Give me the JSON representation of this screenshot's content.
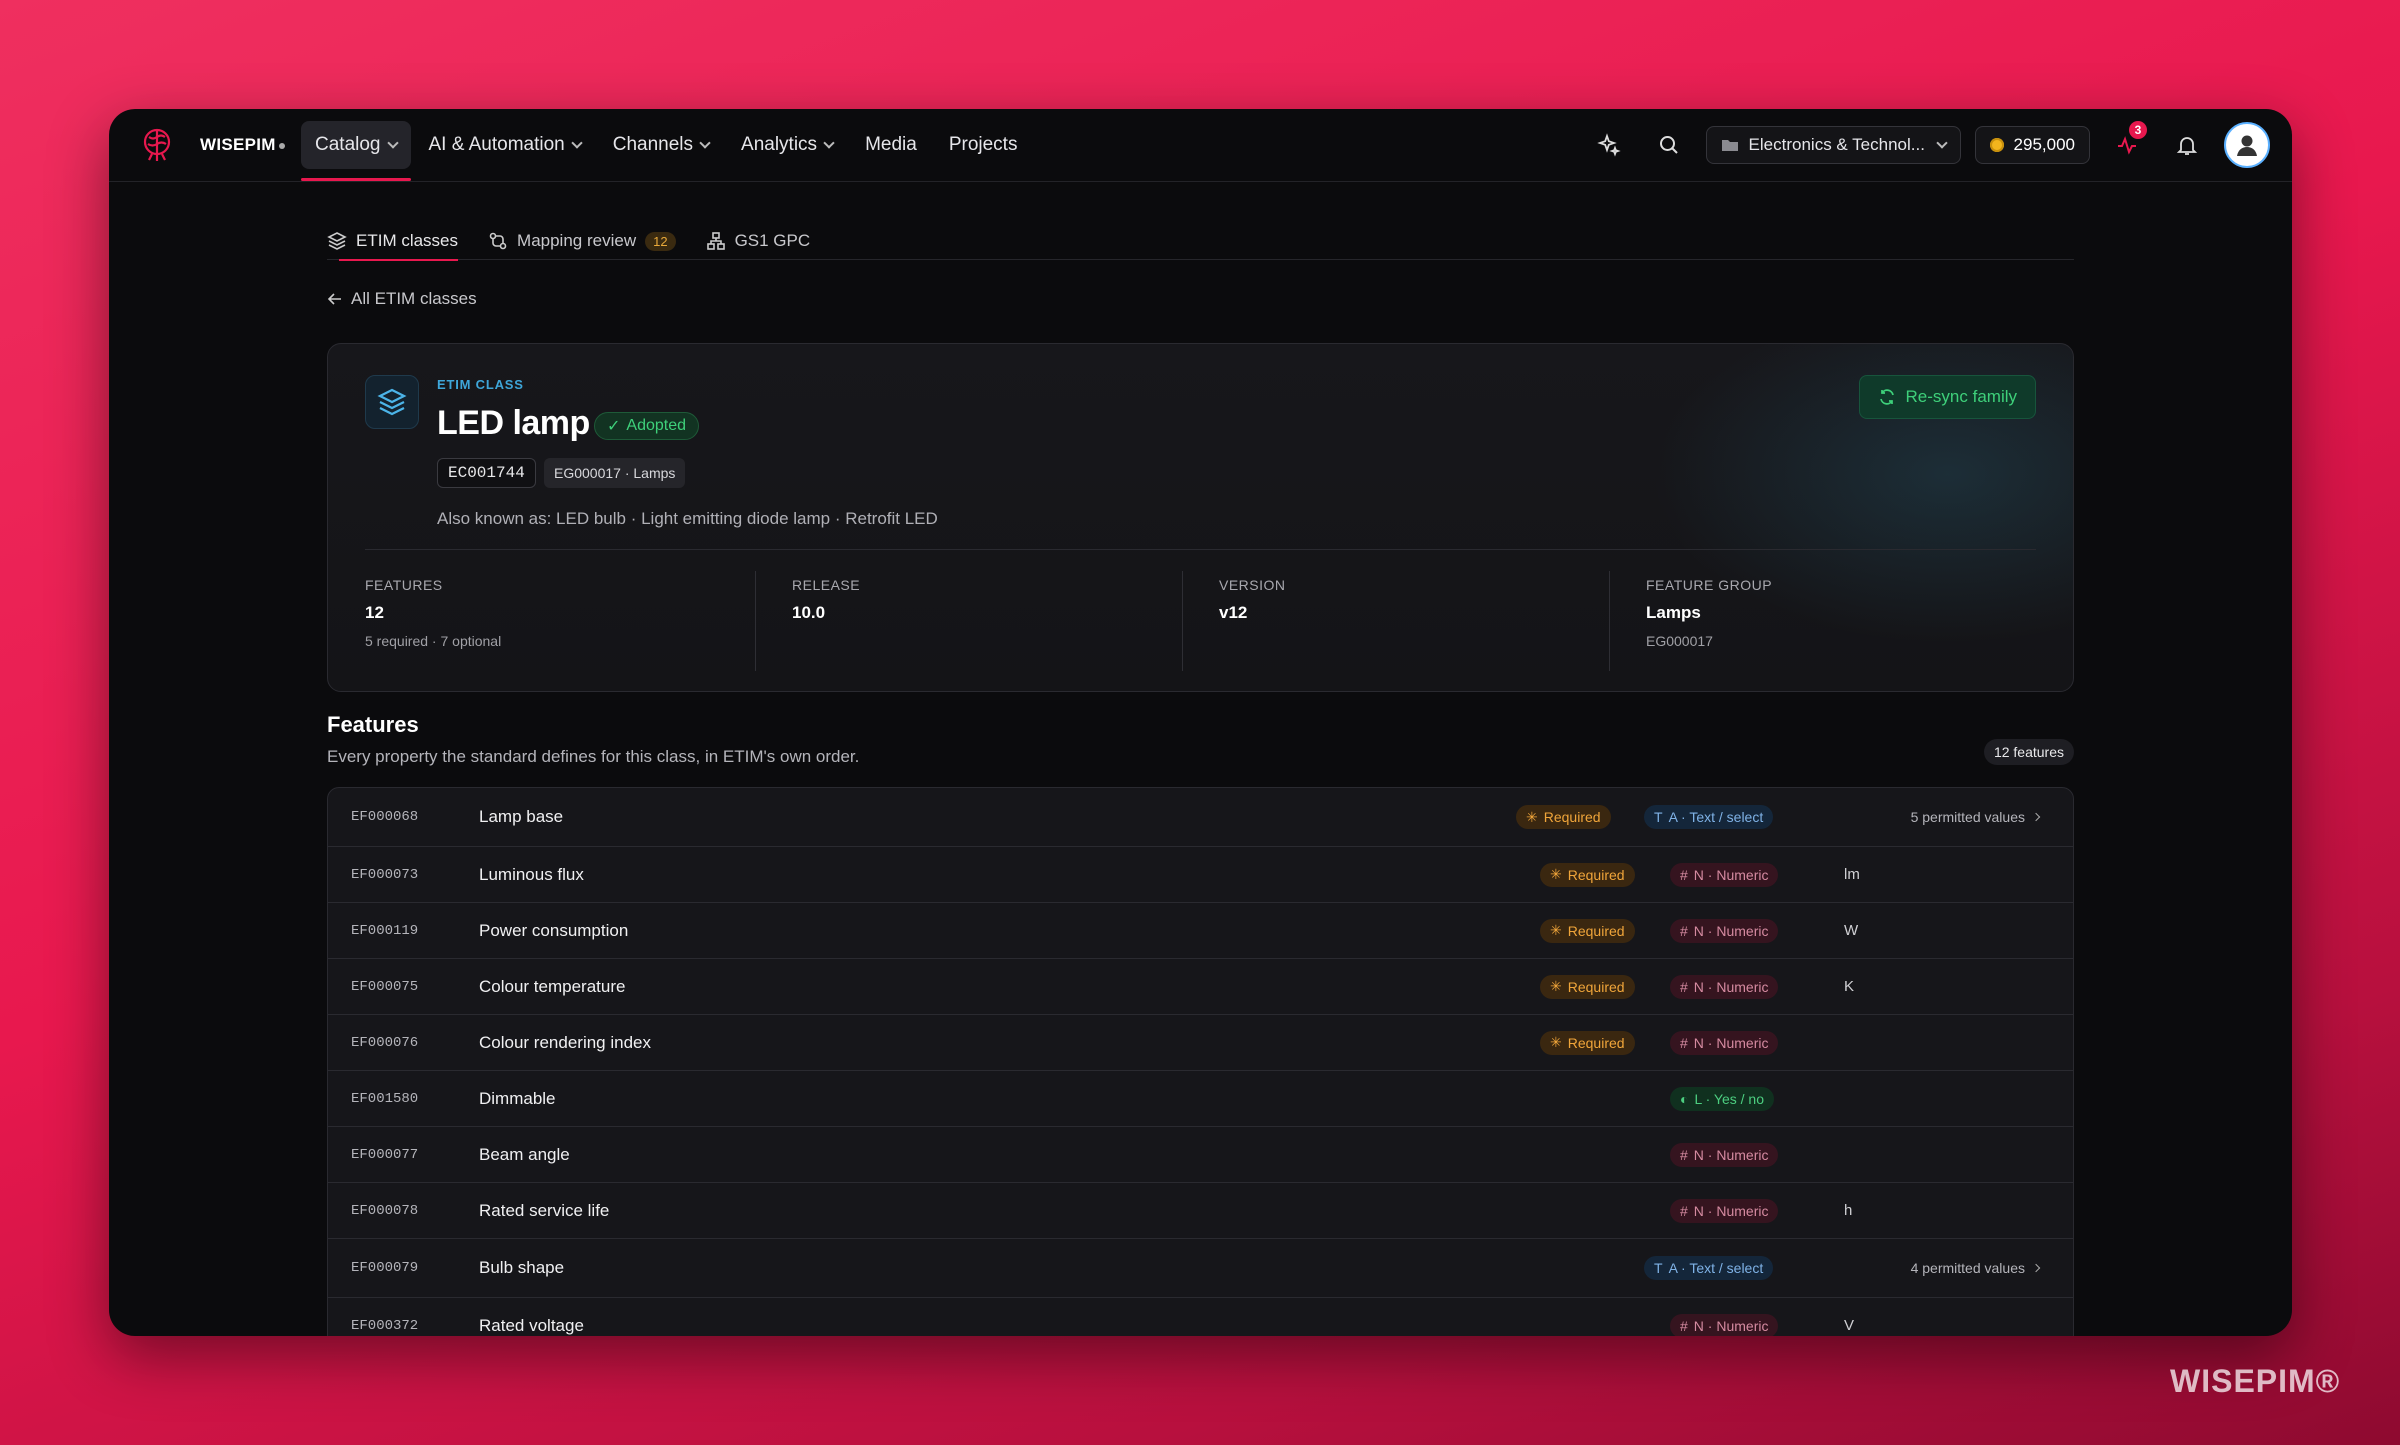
{
  "brand": {
    "name": "WISEPIM"
  },
  "nav": {
    "items": [
      {
        "label": "Catalog",
        "dropdown": true
      },
      {
        "label": "AI & Automation",
        "dropdown": true
      },
      {
        "label": "Channels",
        "dropdown": true
      },
      {
        "label": "Analytics",
        "dropdown": true
      },
      {
        "label": "Media",
        "dropdown": false
      },
      {
        "label": "Projects",
        "dropdown": false
      }
    ]
  },
  "topbar": {
    "workspace": "Electronics & Technol...",
    "credits": "295,000",
    "notifications_count": "3"
  },
  "subtabs": [
    {
      "label": "ETIM classes",
      "active": true
    },
    {
      "label": "Mapping review",
      "count": "12"
    },
    {
      "label": "GS1 GPC"
    }
  ],
  "back_link": "All ETIM classes",
  "class_card": {
    "eyebrow": "ETIM CLASS",
    "title": "LED lamp",
    "status": "Adopted",
    "code": "EC001744",
    "group": "EG000017 · Lamps",
    "aka": "Also known as: LED bulb · Light emitting diode lamp · Retrofit LED",
    "resync_label": "Re-sync family",
    "stats": [
      {
        "label": "FEATURES",
        "value": "12",
        "sub": "5 required · 7 optional"
      },
      {
        "label": "RELEASE",
        "value": "10.0",
        "sub": ""
      },
      {
        "label": "VERSION",
        "value": "v12",
        "sub": ""
      },
      {
        "label": "FEATURE GROUP",
        "value": "Lamps",
        "sub": "EG000017"
      }
    ]
  },
  "features_section": {
    "title": "Features",
    "description": "Every property the standard defines for this class, in ETIM's own order.",
    "count_label": "12 features"
  },
  "features": [
    {
      "code": "EF000068",
      "name": "Lamp base",
      "required": "Required",
      "type": "A · Text / select",
      "kind": "text",
      "unit": "",
      "permitted": "5 permitted values"
    },
    {
      "code": "EF000073",
      "name": "Luminous flux",
      "required": "Required",
      "type": "N · Numeric",
      "kind": "numeric",
      "unit": "lm",
      "permitted": ""
    },
    {
      "code": "EF000119",
      "name": "Power consumption",
      "required": "Required",
      "type": "N · Numeric",
      "kind": "numeric",
      "unit": "W",
      "permitted": ""
    },
    {
      "code": "EF000075",
      "name": "Colour temperature",
      "required": "Required",
      "type": "N · Numeric",
      "kind": "numeric",
      "unit": "K",
      "permitted": ""
    },
    {
      "code": "EF000076",
      "name": "Colour rendering index",
      "required": "Required",
      "type": "N · Numeric",
      "kind": "numeric",
      "unit": "",
      "permitted": ""
    },
    {
      "code": "EF001580",
      "name": "Dimmable",
      "required": "",
      "type": "L · Yes / no",
      "kind": "bool",
      "unit": "",
      "permitted": ""
    },
    {
      "code": "EF000077",
      "name": "Beam angle",
      "required": "",
      "type": "N · Numeric",
      "kind": "numeric",
      "unit": "",
      "permitted": ""
    },
    {
      "code": "EF000078",
      "name": "Rated service life",
      "required": "",
      "type": "N · Numeric",
      "kind": "numeric",
      "unit": "h",
      "permitted": ""
    },
    {
      "code": "EF000079",
      "name": "Bulb shape",
      "required": "",
      "type": "A · Text / select",
      "kind": "text",
      "unit": "",
      "permitted": "4 permitted values"
    },
    {
      "code": "EF000372",
      "name": "Rated voltage",
      "required": "",
      "type": "N · Numeric",
      "kind": "numeric",
      "unit": "V",
      "permitted": ""
    }
  ],
  "watermark": "WISEPIM®",
  "colors": {
    "accent": "#e8184e",
    "success": "#3ed07a",
    "info": "#3ea6d9",
    "warning": "#f0a53a"
  }
}
